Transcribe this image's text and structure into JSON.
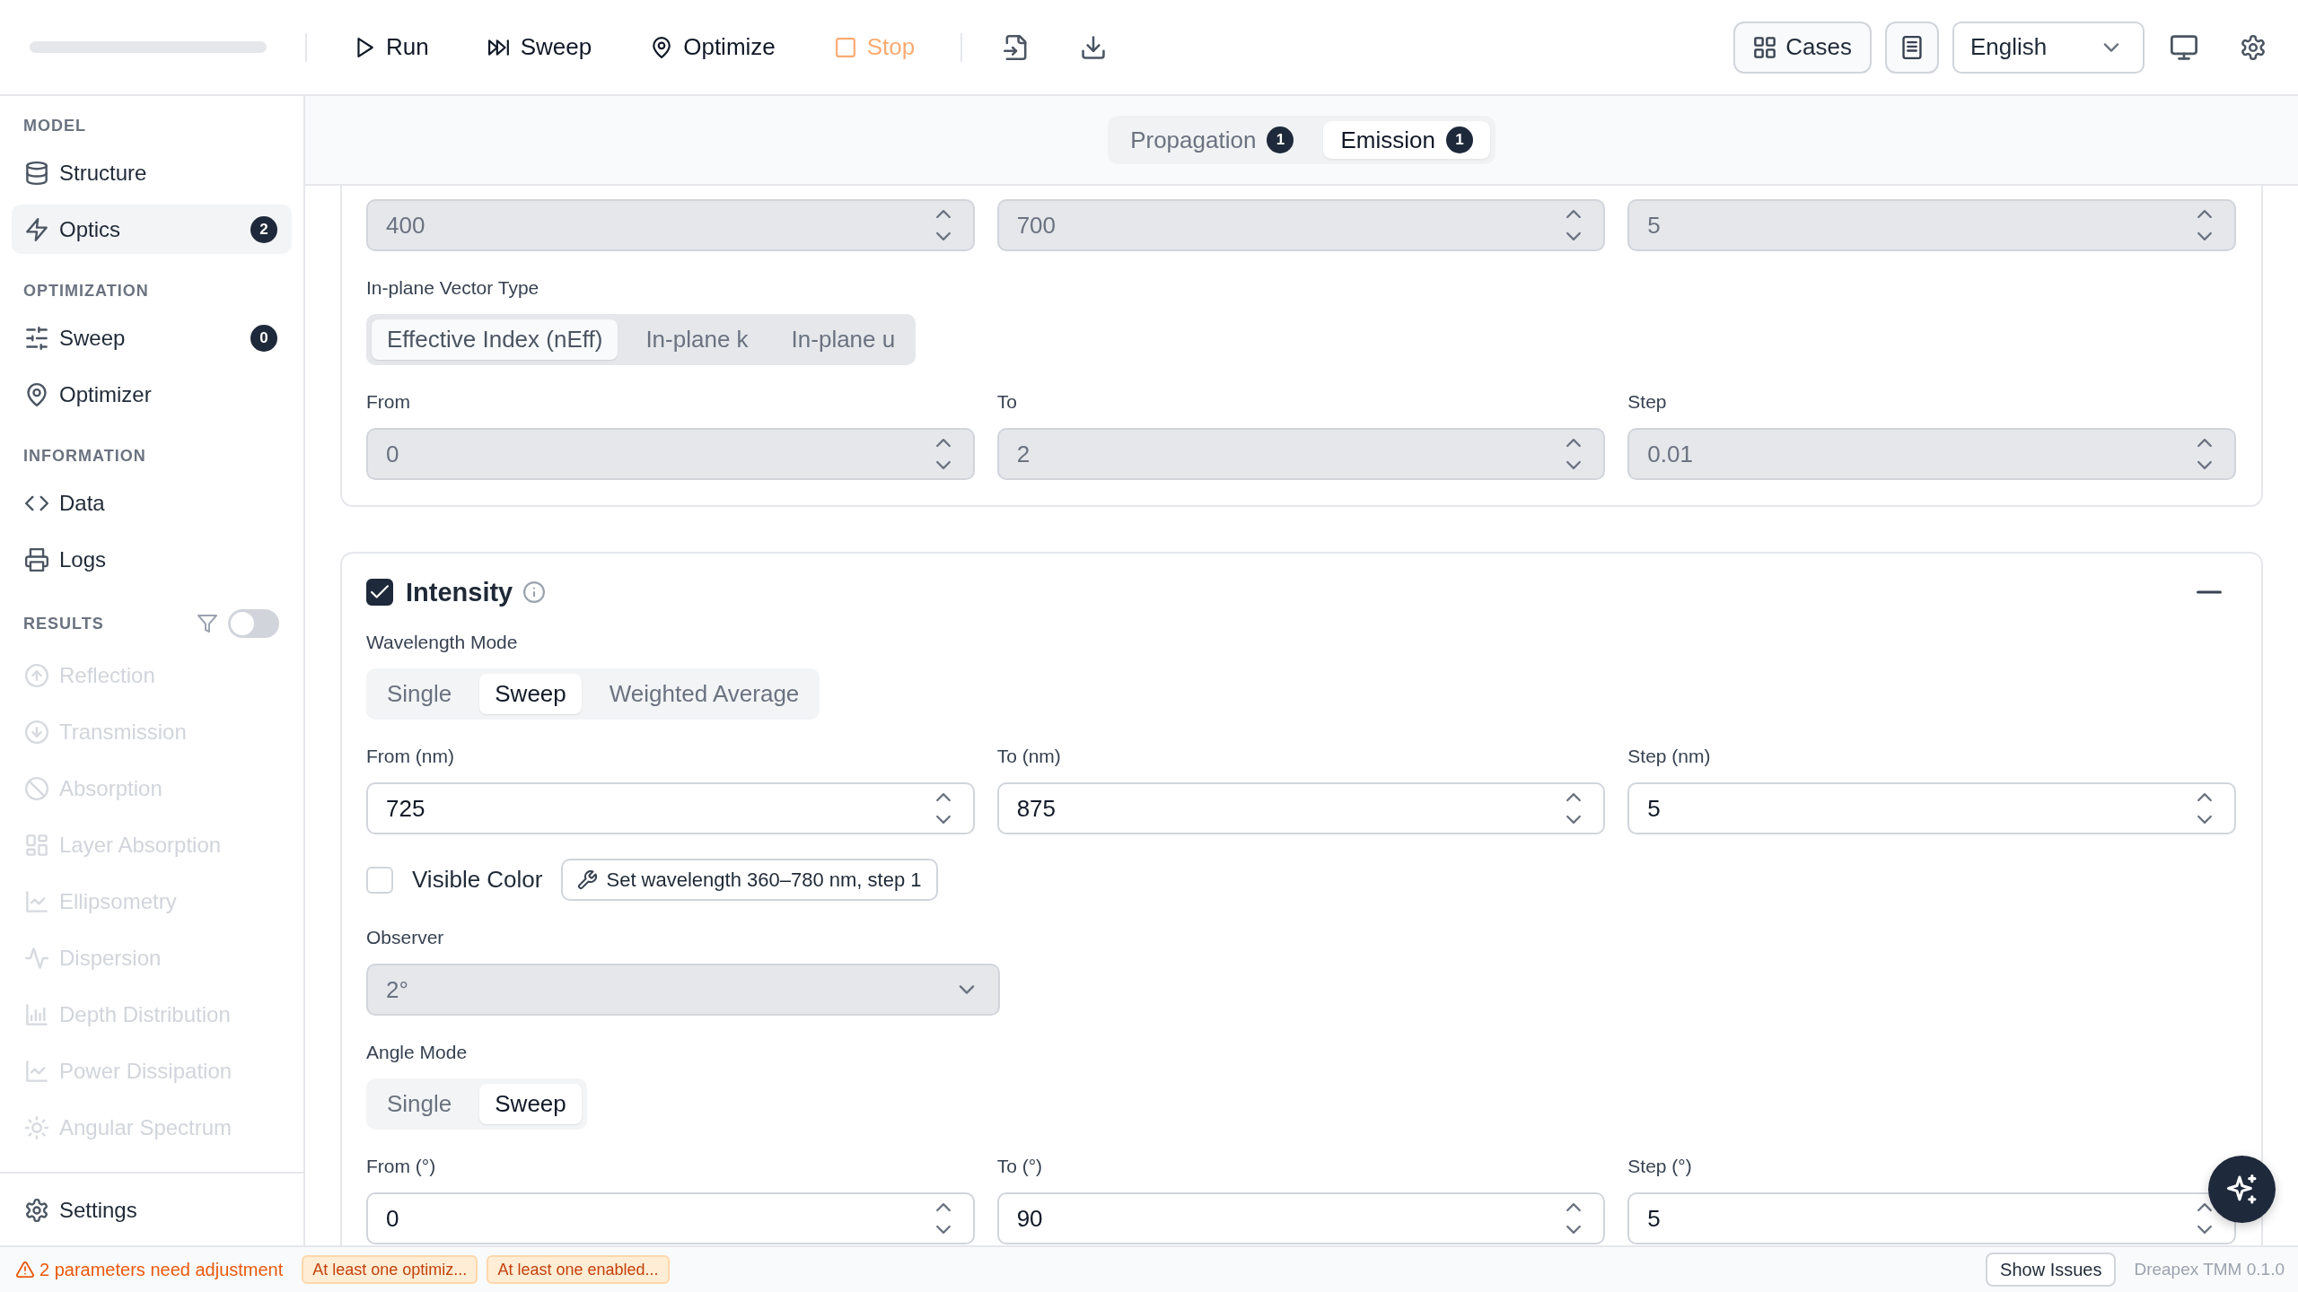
{
  "toolbar": {
    "actions": [
      {
        "label": "Run",
        "kind": "default",
        "disabled": false
      },
      {
        "label": "Sweep",
        "kind": "default",
        "disabled": false
      },
      {
        "label": "Optimize",
        "kind": "default",
        "disabled": false
      },
      {
        "label": "Stop",
        "kind": "danger",
        "disabled": true
      }
    ],
    "cases_button": "Cases",
    "language": "English"
  },
  "sidebar": {
    "sections": [
      {
        "title": "MODEL",
        "items": [
          {
            "label": "Structure",
            "selected": false,
            "disabled": false
          },
          {
            "label": "Optics",
            "badge": "2",
            "selected": true,
            "disabled": false
          }
        ]
      },
      {
        "title": "OPTIMIZATION",
        "items": [
          {
            "label": "Sweep",
            "badge": "0",
            "selected": false,
            "disabled": false
          },
          {
            "label": "Optimizer",
            "selected": false,
            "disabled": false
          }
        ]
      },
      {
        "title": "INFORMATION",
        "items": [
          {
            "label": "Data",
            "selected": false,
            "disabled": false
          },
          {
            "label": "Logs",
            "selected": false,
            "disabled": false
          }
        ]
      },
      {
        "title": "RESULTS",
        "toggle": {
          "on": false
        },
        "items": [
          {
            "label": "Reflection",
            "selected": false,
            "disabled": true
          },
          {
            "label": "Transmission",
            "selected": false,
            "disabled": true
          },
          {
            "label": "Absorption",
            "selected": false,
            "disabled": true
          },
          {
            "label": "Layer Absorption",
            "selected": false,
            "disabled": true
          },
          {
            "label": "Ellipsometry",
            "selected": false,
            "disabled": true
          },
          {
            "label": "Dispersion",
            "selected": false,
            "disabled": true
          },
          {
            "label": "Depth Distribution",
            "selected": false,
            "disabled": true
          },
          {
            "label": "Power Dissipation",
            "selected": false,
            "disabled": true
          },
          {
            "label": "Angular Spectrum",
            "selected": false,
            "disabled": true
          }
        ]
      }
    ],
    "footer": {
      "label": "Settings"
    }
  },
  "view_tabs": [
    {
      "label": "Propagation",
      "count": "1",
      "selected": false
    },
    {
      "label": "Emission",
      "count": "1",
      "selected": true
    }
  ],
  "cards": [
    {
      "blocks": [
        {
          "kind": "fields",
          "fields": [
            {
              "value": "400",
              "disabled": true
            },
            {
              "value": "700",
              "disabled": true
            },
            {
              "value": "5",
              "disabled": true
            }
          ]
        },
        {
          "kind": "segmented",
          "label": "In-plane Vector Type",
          "disabled": true,
          "options": [
            {
              "label": "Effective Index (nEff)",
              "selected": true
            },
            {
              "label": "In-plane k",
              "selected": false
            },
            {
              "label": "In-plane u",
              "selected": false
            }
          ]
        },
        {
          "kind": "fields",
          "fields": [
            {
              "label": "From",
              "value": "0",
              "disabled": true
            },
            {
              "label": "To",
              "value": "2",
              "disabled": true
            },
            {
              "label": "Step",
              "value": "0.01",
              "disabled": true
            }
          ]
        }
      ]
    },
    {
      "header": {
        "title": "Intensity",
        "checked": true
      },
      "blocks": [
        {
          "kind": "segmented",
          "label": "Wavelength Mode",
          "disabled": false,
          "options": [
            {
              "label": "Single",
              "selected": false
            },
            {
              "label": "Sweep",
              "selected": true
            },
            {
              "label": "Weighted Average",
              "selected": false
            }
          ]
        },
        {
          "kind": "fields",
          "fields": [
            {
              "label": "From (nm)",
              "value": "725",
              "disabled": false
            },
            {
              "label": "To (nm)",
              "value": "875",
              "disabled": false
            },
            {
              "label": "Step (nm)",
              "value": "5",
              "disabled": false
            }
          ]
        },
        {
          "kind": "checkbox_row",
          "label": "Visible Color",
          "checked": false,
          "button": "Set wavelength 360–780 nm, step 1"
        },
        {
          "kind": "select",
          "label": "Observer",
          "value": "2°",
          "disabled": true
        },
        {
          "kind": "segmented",
          "label": "Angle Mode",
          "disabled": false,
          "options": [
            {
              "label": "Single",
              "selected": false
            },
            {
              "label": "Sweep",
              "selected": true
            }
          ]
        },
        {
          "kind": "fields",
          "fields": [
            {
              "label": "From (°)",
              "value": "0",
              "disabled": false
            },
            {
              "label": "To (°)",
              "value": "90",
              "disabled": false
            },
            {
              "label": "Step (°)",
              "value": "5",
              "disabled": false
            }
          ]
        }
      ]
    }
  ],
  "status_bar": {
    "warning": "2 parameters need adjustment",
    "issues": [
      "At least one optimiz...",
      "At least one enabled..."
    ],
    "button": "Show Issues",
    "version": "Dreapex TMM 0.1.0"
  }
}
